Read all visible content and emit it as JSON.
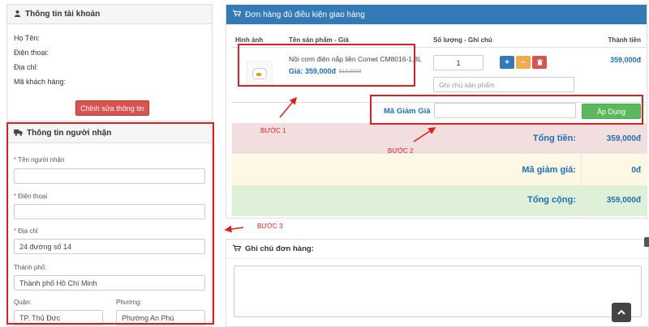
{
  "account": {
    "title": "Thông tin tài khoản",
    "fields": [
      "Họ Tên:",
      "Điện thoại:",
      "Địa chỉ:",
      "Mã khách hàng:"
    ],
    "edit_button": "Chỉnh sửa thông tin"
  },
  "receiver": {
    "title": "Thông tin người nhận",
    "required_mark": "*",
    "name_label": "Tên người nhận",
    "phone_label": "Điện thoại",
    "address_label": "Địa chỉ",
    "address_value": "24 đường số 14",
    "city_label": "Thành phố:",
    "city_value": "Thành phố Hồ Chí Minh",
    "district_label": "Quận:",
    "district_value": "TP. Thủ Đức",
    "ward_label": "Phường:",
    "ward_value": "Phường An Phú"
  },
  "order": {
    "title": "Đơn hàng đủ điều kiện giao hàng",
    "col_image": "Hình ảnh",
    "col_product": "Tên sản phẩm - Giá",
    "col_qty": "Số lượng - Ghi chú",
    "col_total": "Thành tiền",
    "product_name": "Nồi cơm điện nắp liền Comet CM8016-1,8L",
    "product_price": "Giá: 359,000đ",
    "product_old_price": "519,000đ",
    "quantity": "1",
    "note_placeholder": "Ghi chú sản phẩm",
    "row_total": "359,000đ",
    "plus_symbol": "+",
    "minus_symbol": "−",
    "delete_symbol": "🗑",
    "coupon_label": "Mã Giảm Giá",
    "apply_button": "Áp Dụng",
    "subtotal_label": "Tổng tiền:",
    "subtotal_value": "359,000đ",
    "discount_label": "Mã giảm giá:",
    "discount_value": "0đ",
    "grand_label": "Tổng cộng:",
    "grand_value": "359,000đ"
  },
  "order_note": {
    "title": "Ghi chú đơn hàng:"
  },
  "annotations": {
    "step1": "BƯỚC 1",
    "step2": "BƯỚC 2",
    "step3": "BƯỚC 3",
    "color": "#e02020"
  },
  "icons": {
    "user": "user-icon",
    "truck": "truck-icon",
    "cart": "cart-icon",
    "scroll_top": "chevron-up-icon"
  },
  "colors": {
    "primary": "#337ab7",
    "danger": "#d9534f",
    "warning": "#f0ad4e",
    "success": "#5cb85c",
    "price": "#1e6fb5"
  }
}
